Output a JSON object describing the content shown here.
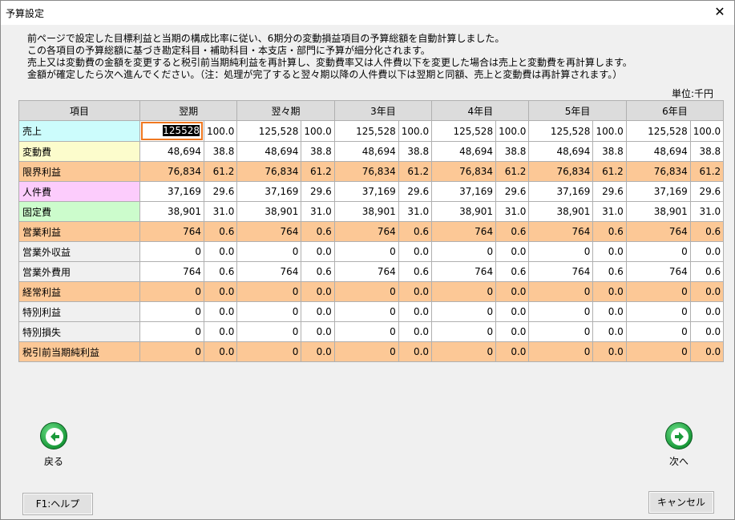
{
  "window": {
    "title": "予算設定",
    "close_glyph": "✕"
  },
  "instructions": [
    "前ページで設定した目標利益と当期の構成比率に従い、6期分の変動損益項目の予算総額を自動計算しました。",
    "この各項目の予算総額に基づき勘定科目・補助科目・本支店・部門に予算が細分化されます。",
    "売上又は変動費の金額を変更すると税引前当期純利益を再計算し、変動費率又は人件費以下を変更した場合は売上と変動費を再計算します。",
    "金額が確定したら次へ進んでください。（注：処理が完了すると翌々期以降の人件費以下は翌期と同額、売上と変動費は再計算されます。）"
  ],
  "unit": "単位:千円",
  "table": {
    "header_item": "項目",
    "periods": [
      "翌期",
      "翌々期",
      "3年目",
      "4年目",
      "5年目",
      "6年目"
    ],
    "editing_value": "125528",
    "rows": [
      {
        "label": "売上",
        "style": "cyan",
        "cells": [
          [
            "125528",
            "100.0"
          ],
          [
            "125,528",
            "100.0"
          ],
          [
            "125,528",
            "100.0"
          ],
          [
            "125,528",
            "100.0"
          ],
          [
            "125,528",
            "100.0"
          ],
          [
            "125,528",
            "100.0"
          ]
        ]
      },
      {
        "label": "変動費",
        "style": "yellow",
        "cells": [
          [
            "48,694",
            "38.8"
          ],
          [
            "48,694",
            "38.8"
          ],
          [
            "48,694",
            "38.8"
          ],
          [
            "48,694",
            "38.8"
          ],
          [
            "48,694",
            "38.8"
          ],
          [
            "48,694",
            "38.8"
          ]
        ]
      },
      {
        "label": "限界利益",
        "style": "hl",
        "cells": [
          [
            "76,834",
            "61.2"
          ],
          [
            "76,834",
            "61.2"
          ],
          [
            "76,834",
            "61.2"
          ],
          [
            "76,834",
            "61.2"
          ],
          [
            "76,834",
            "61.2"
          ],
          [
            "76,834",
            "61.2"
          ]
        ]
      },
      {
        "label": "人件費",
        "style": "pink",
        "cells": [
          [
            "37,169",
            "29.6"
          ],
          [
            "37,169",
            "29.6"
          ],
          [
            "37,169",
            "29.6"
          ],
          [
            "37,169",
            "29.6"
          ],
          [
            "37,169",
            "29.6"
          ],
          [
            "37,169",
            "29.6"
          ]
        ]
      },
      {
        "label": "固定費",
        "style": "green",
        "cells": [
          [
            "38,901",
            "31.0"
          ],
          [
            "38,901",
            "31.0"
          ],
          [
            "38,901",
            "31.0"
          ],
          [
            "38,901",
            "31.0"
          ],
          [
            "38,901",
            "31.0"
          ],
          [
            "38,901",
            "31.0"
          ]
        ]
      },
      {
        "label": "営業利益",
        "style": "hl",
        "cells": [
          [
            "764",
            "0.6"
          ],
          [
            "764",
            "0.6"
          ],
          [
            "764",
            "0.6"
          ],
          [
            "764",
            "0.6"
          ],
          [
            "764",
            "0.6"
          ],
          [
            "764",
            "0.6"
          ]
        ]
      },
      {
        "label": "営業外収益",
        "style": "gray",
        "cells": [
          [
            "0",
            "0.0"
          ],
          [
            "0",
            "0.0"
          ],
          [
            "0",
            "0.0"
          ],
          [
            "0",
            "0.0"
          ],
          [
            "0",
            "0.0"
          ],
          [
            "0",
            "0.0"
          ]
        ]
      },
      {
        "label": "営業外費用",
        "style": "gray",
        "cells": [
          [
            "764",
            "0.6"
          ],
          [
            "764",
            "0.6"
          ],
          [
            "764",
            "0.6"
          ],
          [
            "764",
            "0.6"
          ],
          [
            "764",
            "0.6"
          ],
          [
            "764",
            "0.6"
          ]
        ]
      },
      {
        "label": "経常利益",
        "style": "hl",
        "cells": [
          [
            "0",
            "0.0"
          ],
          [
            "0",
            "0.0"
          ],
          [
            "0",
            "0.0"
          ],
          [
            "0",
            "0.0"
          ],
          [
            "0",
            "0.0"
          ],
          [
            "0",
            "0.0"
          ]
        ]
      },
      {
        "label": "特別利益",
        "style": "gray",
        "cells": [
          [
            "0",
            "0.0"
          ],
          [
            "0",
            "0.0"
          ],
          [
            "0",
            "0.0"
          ],
          [
            "0",
            "0.0"
          ],
          [
            "0",
            "0.0"
          ],
          [
            "0",
            "0.0"
          ]
        ]
      },
      {
        "label": "特別損失",
        "style": "gray",
        "cells": [
          [
            "0",
            "0.0"
          ],
          [
            "0",
            "0.0"
          ],
          [
            "0",
            "0.0"
          ],
          [
            "0",
            "0.0"
          ],
          [
            "0",
            "0.0"
          ],
          [
            "0",
            "0.0"
          ]
        ]
      },
      {
        "label": "税引前当期純利益",
        "style": "hl",
        "cells": [
          [
            "0",
            "0.0"
          ],
          [
            "0",
            "0.0"
          ],
          [
            "0",
            "0.0"
          ],
          [
            "0",
            "0.0"
          ],
          [
            "0",
            "0.0"
          ],
          [
            "0",
            "0.0"
          ]
        ]
      }
    ]
  },
  "nav": {
    "back_label": "戻る",
    "next_label": "次へ"
  },
  "buttons": {
    "help_label": "F1:ヘルプ",
    "cancel_label": "キャンセル"
  },
  "colors": {
    "highlight_row": "#fcc896",
    "focus_border": "#f07820",
    "nav_green": "#1a9a3a"
  }
}
